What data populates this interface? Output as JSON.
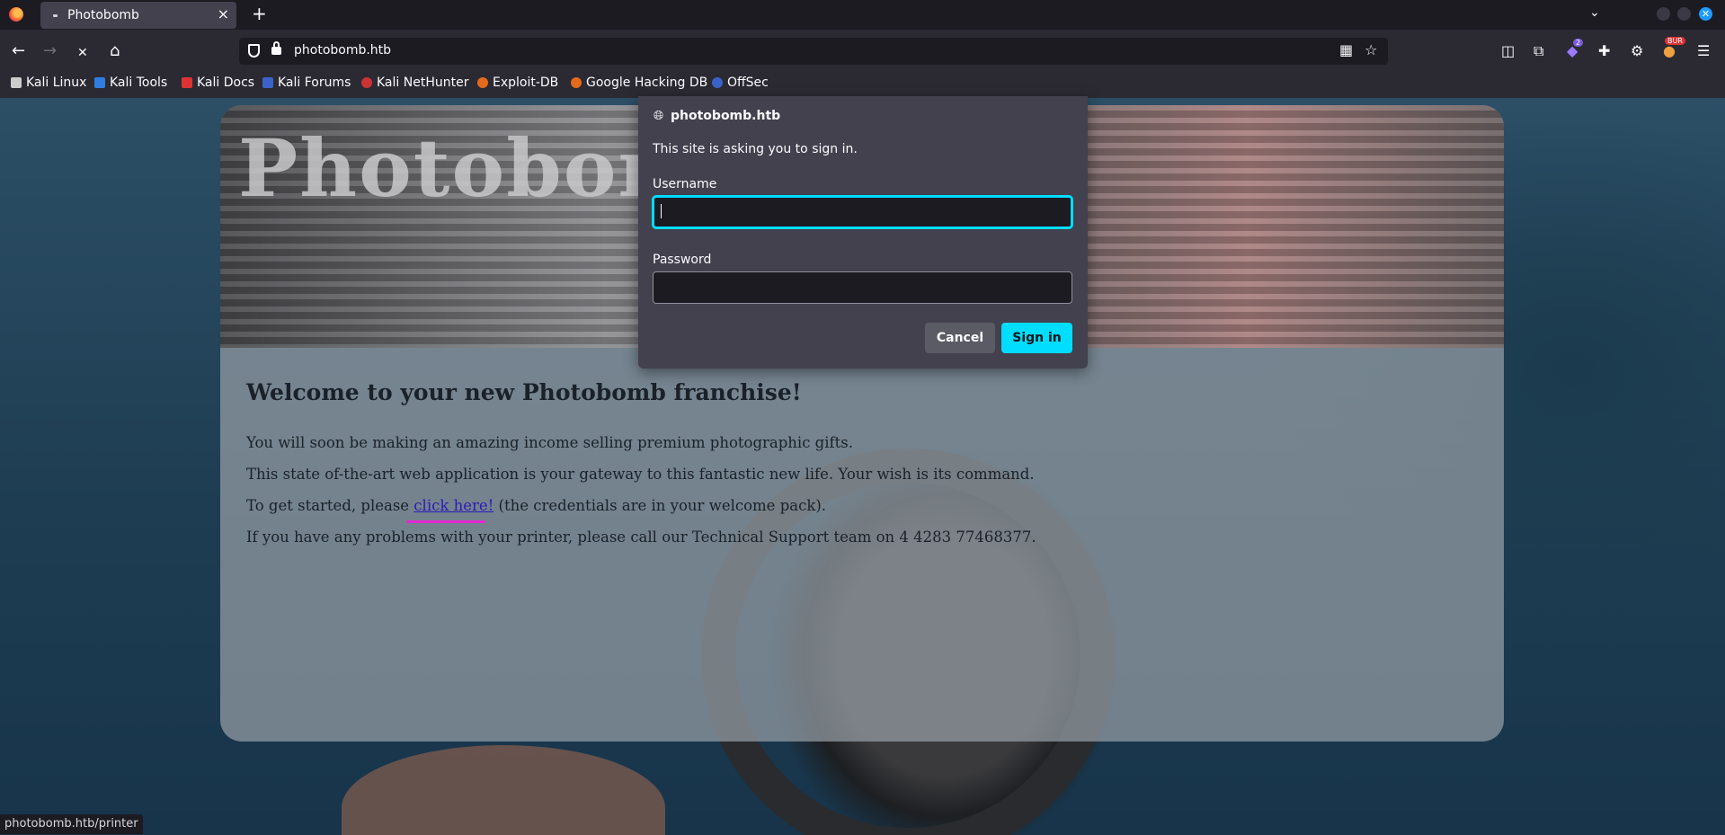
{
  "browser": {
    "tab_title": "Photobomb",
    "tab_close": "×",
    "new_tab": "+",
    "url": "photobomb.htb",
    "status_url": "photobomb.htb/printer",
    "extension_badge": "2",
    "profile_badge": "BUR",
    "accent_color": "#00ddff",
    "icons": {
      "back": "←",
      "forward": "→",
      "stop": "✕",
      "home": "⌂",
      "grid": "▦",
      "star": "☆",
      "pocket": "◫",
      "extensions": "⧉",
      "puzzle": "✚",
      "gear": "⚙",
      "menu": "☰",
      "tab_list": "⌄",
      "window_close": "✕"
    }
  },
  "bookmarks": [
    {
      "label": "Kali Linux",
      "color": "#222"
    },
    {
      "label": "Kali Tools",
      "color": "#2f7de1"
    },
    {
      "label": "Kali Docs",
      "color": "#d33"
    },
    {
      "label": "Kali Forums",
      "color": "#3b63c9"
    },
    {
      "label": "Kali NetHunter",
      "color": "#c33"
    },
    {
      "label": "Exploit-DB",
      "color": "#e46a1c"
    },
    {
      "label": "Google Hacking DB",
      "color": "#e46a1c"
    },
    {
      "label": "OffSec",
      "color": "#3a63c9"
    }
  ],
  "page": {
    "banner_title": "Photobomb",
    "heading": "Welcome to your new Photobomb franchise!",
    "para1": "You will soon be making an amazing income selling premium photographic gifts.",
    "para2": "This state of-the-art web application is your gateway to this fantastic new life. Your wish is its command.",
    "para3_before": "To get started, please ",
    "para3_link": "click here!",
    "para3_after": " (the credentials are in your welcome pack).",
    "para4": "If you have any problems with your printer, please call our Technical Support team on 4 4283 77468377."
  },
  "dialog": {
    "host": "photobomb.htb",
    "message": "This site is asking you to sign in.",
    "username_label": "Username",
    "username_value": "",
    "password_label": "Password",
    "password_value": "",
    "cancel_label": "Cancel",
    "signin_label": "Sign in"
  }
}
